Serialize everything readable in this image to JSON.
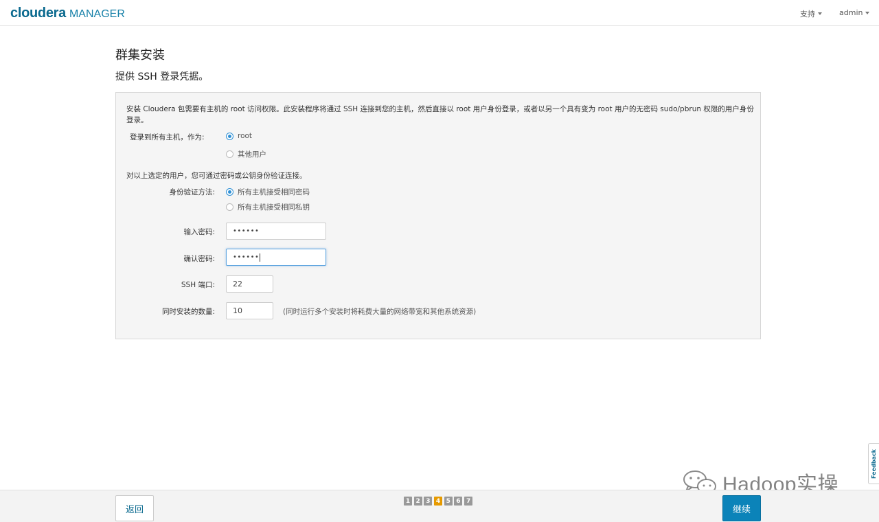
{
  "header": {
    "logo_main": "cloudera",
    "logo_sub": "MANAGER",
    "support_label": "支持",
    "user_label": "admin"
  },
  "page": {
    "title": "群集安装",
    "subtitle": "提供 SSH 登录凭据。"
  },
  "form": {
    "intro_text": "安装 Cloudera 包需要有主机的 root 访问权限。此安装程序将通过 SSH 连接到您的主机，然后直接以 root 用户身份登录，或者以另一个具有变为 root 用户的无密码 sudo/pbrun 权限的用户身份登录。",
    "login_as_label": "登录到所有主机，作为:",
    "login_options": [
      {
        "label": "root",
        "checked": true
      },
      {
        "label": "其他用户",
        "checked": false
      }
    ],
    "auth_note": "对以上选定的用户，您可通过密码或公钥身份验证连接。",
    "auth_method_label": "身份验证方法:",
    "auth_options": [
      {
        "label": "所有主机接受相同密码",
        "checked": true
      },
      {
        "label": "所有主机接受相同私钥",
        "checked": false
      }
    ],
    "password_label": "输入密码:",
    "password_value": "••••••",
    "confirm_label": "确认密码:",
    "confirm_value": "••••••",
    "ssh_port_label": "SSH 端口:",
    "ssh_port_value": "22",
    "concurrent_label": "同时安装的数量:",
    "concurrent_value": "10",
    "concurrent_hint": "(同时运行多个安装时将耗费大量的网络带宽和其他系统资源)"
  },
  "footer": {
    "back_label": "返回",
    "continue_label": "继续",
    "steps": [
      "1",
      "2",
      "3",
      "4",
      "5",
      "6",
      "7"
    ],
    "active_step": "4"
  },
  "watermark": {
    "text": "Hadoop实操"
  },
  "feedback_label": "Feedback",
  "colors": {
    "brand": "#0b6a8f",
    "primary_button": "#0b83b9",
    "active_step": "#e69a00",
    "radio_checked": "#2d8fd5"
  }
}
